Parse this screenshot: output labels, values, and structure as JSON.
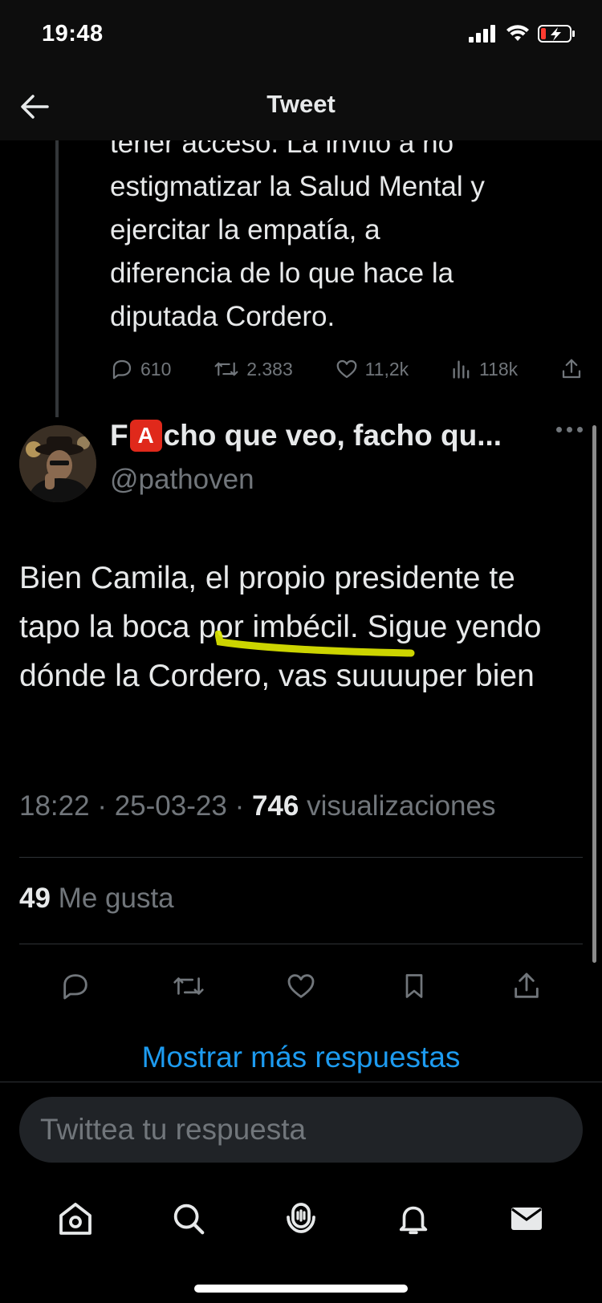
{
  "status_bar": {
    "time": "19:48"
  },
  "nav": {
    "title": "Tweet"
  },
  "previous_tweet": {
    "text_lines": [
      "tener acceso. La invito a no",
      "estigmatizar la Salud Mental y",
      "ejercitar la empatía, a",
      "diferencia de lo que hace la",
      "diputada Cordero."
    ],
    "replies": "610",
    "retweets": "2.383",
    "likes": "11,2k",
    "views": "118k"
  },
  "tweet": {
    "author_name_prefix": "F",
    "author_name_badge": "A",
    "author_name_suffix": "cho que veo, facho qu...",
    "handle": "@pathoven",
    "text": "Bien Camila, el propio presidente te tapo la boca por imbécil. Sigue yendo dónde la Cordero, vas suuuuper bien",
    "time": "18:22",
    "date": "25-03-23",
    "views_count": "746",
    "views_label": "visualizaciones",
    "likes_count": "49",
    "likes_label": "Me gusta"
  },
  "show_more_replies": "Mostrar más respuestas",
  "reply_box": {
    "placeholder": "Twittea tu respuesta"
  },
  "colors": {
    "accent": "#1d9bf0",
    "background": "#000000",
    "secondary_text": "#71767b",
    "highlight": "#e4f000"
  },
  "icons": [
    "back-arrow-icon",
    "reply-icon",
    "retweet-icon",
    "like-icon",
    "views-icon",
    "share-icon",
    "bookmark-icon",
    "home-icon",
    "search-icon",
    "spaces-icon",
    "bell-icon",
    "mail-icon"
  ]
}
